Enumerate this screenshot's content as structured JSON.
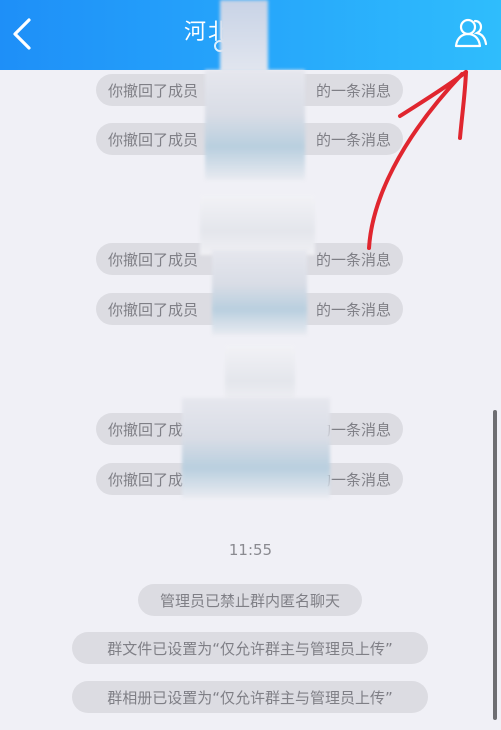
{
  "header": {
    "back_icon": "chevron-left-icon",
    "title": "河北",
    "profile_icon": "group-members-icon"
  },
  "messages": [
    {
      "left": "你撤回了成员",
      "right": "的一条消息"
    },
    {
      "left": "你撤回了成员",
      "right": "的一条消息"
    },
    {
      "left": "你撤回了成员",
      "right": "的一条消息"
    },
    {
      "left": "你撤回了成员",
      "right": "的一条消息"
    },
    {
      "left": "你撤回了成员",
      "right": "的一条消息"
    },
    {
      "left": "你撤回了成员",
      "right": "的一条消息"
    }
  ],
  "timestamp": "11:55",
  "system_notices": [
    "管理员已禁止群内匿名聊天",
    "群文件已设置为“仅允许群主与管理员上传”",
    "群相册已设置为“仅允许群主与管理员上传”"
  ],
  "colors": {
    "header_start": "#1e8ff8",
    "header_end": "#2fbdfc",
    "background": "#f0f0f6",
    "pill": "#dcdce2",
    "annotation_arrow": "#e0262f"
  }
}
